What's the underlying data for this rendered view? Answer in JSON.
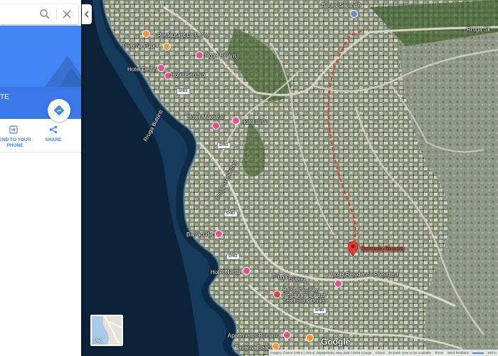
{
  "search": {
    "value": "",
    "placeholder": ""
  },
  "place": {
    "partial_title": "TE",
    "directions_label": "Directions",
    "send_label": "END TO YOUR PHONE",
    "share_label": "SHARE"
  },
  "map": {
    "labels": {
      "bunes_sarande": "Bunes Sarandë",
      "rruga_skenderbeu": "Rruga Sk...",
      "restaurant_la_petite": "Restaurant La Petite",
      "taverna_pupi": "Taverna Pupi",
      "hotel_brilant": "Hotel Brilant",
      "hotel_delfini": "Hotel Delfini",
      "hotel_serxhio": "Hotel Serxhio",
      "hotel_maestral": "Hotel Maestral",
      "hotel_iliria": "Hotel Iliria",
      "rruga_butrinti_top": "Rruga Butrinti",
      "rruga_vertical": "Rruga Skënderbeu",
      "barracuda": "Barracuda",
      "saranda_rooms": "Saranda Rooms",
      "hotel_nertili": "Hotel Nertili",
      "rruga_butrinti": "Rruga Butrinti",
      "hotel_residence_president": "Hotel Residence President",
      "bungalows_bay": "Bungalows Bay",
      "bay_line2": "Restaurant & Pizza",
      "bay_line3": "Sea Food & Drinks",
      "apartments_romario": "Apartments Romario",
      "taverna_beach": "Taverna Beach"
    },
    "road_shields": [
      "SH81",
      "SH81",
      "SH81",
      "SH81",
      "SH81"
    ],
    "map_toggle_label": "Map",
    "google_logo": "Google",
    "footer": {
      "imagery": "Imagery ©2018 CNES / Airbus, DigitalGlobe, Map data ©2018 Google",
      "global": "Global",
      "earth_view": "3D Earth view is not available",
      "terms": "Terms",
      "feedback": "Send feedback",
      "scale": "100 m"
    }
  }
}
